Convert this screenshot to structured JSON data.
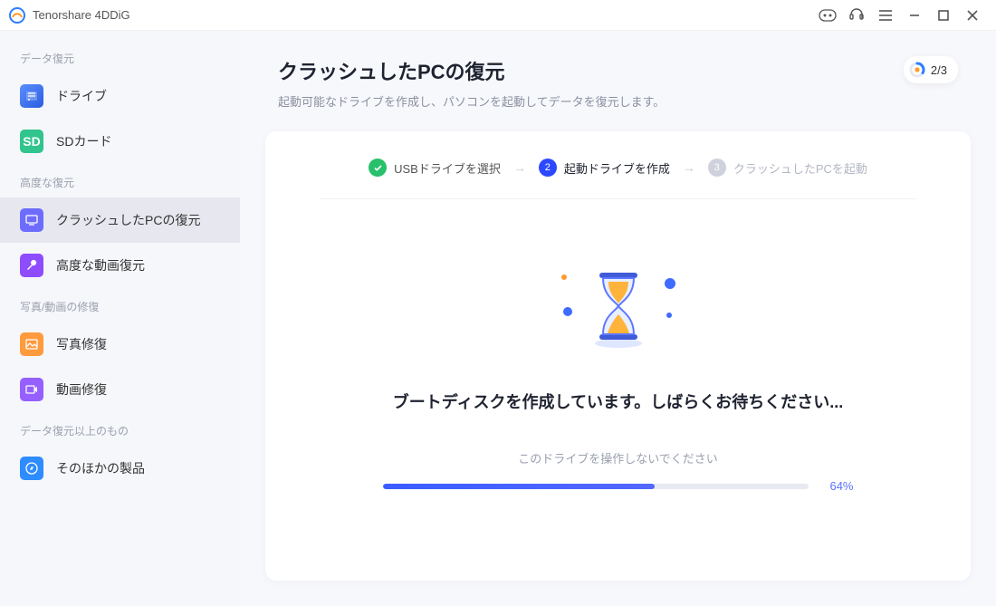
{
  "app": {
    "title": "Tenorshare 4DDiG"
  },
  "stepBadge": "2/3",
  "sidebar": {
    "sections": {
      "data_recovery": "データ復元",
      "advanced_recovery": "高度な復元",
      "media_repair": "写真/動画の修復",
      "more": "データ復元以上のもの"
    },
    "items": {
      "drive": "ドライブ",
      "sd": "SDカード",
      "crash": "クラッシュしたPCの復元",
      "adv_video": "高度な動画復元",
      "photo_repair": "写真修復",
      "video_repair": "動画修復",
      "other_products": "そのほかの製品"
    }
  },
  "page": {
    "title": "クラッシュしたPCの復元",
    "subtitle": "起動可能なドライブを作成し、パソコンを起動してデータを復元します。"
  },
  "steps": {
    "s1": "USBドライブを選択",
    "s2": "起動ドライブを作成",
    "s3": "クラッシュしたPCを起動",
    "n2": "2",
    "n3": "3"
  },
  "status": {
    "creating": "ブートディスクを作成しています。しばらくお待ちください...",
    "warning": "このドライブを操作しないでください",
    "percent_value": 64,
    "percent_label": "64%"
  }
}
